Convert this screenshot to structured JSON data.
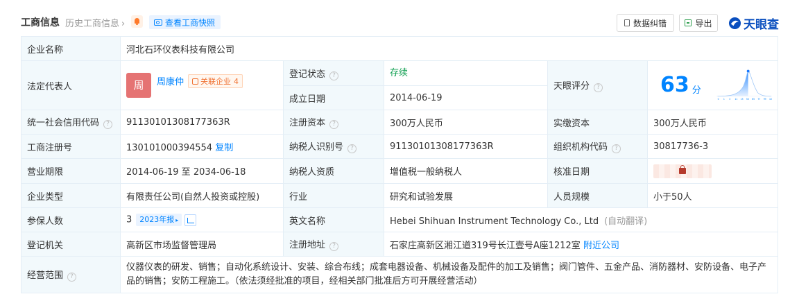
{
  "header": {
    "title": "工商信息",
    "history": "历史工商信息",
    "history_chevron": "›",
    "snapshot": "查看工商快照",
    "correct": "数据纠错",
    "export": "导出",
    "brand": "天眼查"
  },
  "rows": {
    "company_name": {
      "label": "企业名称",
      "value": "河北石环仪表科技有限公司"
    },
    "legal_rep": {
      "label": "法定代表人",
      "avatar": "周",
      "name": "周康仲",
      "assoc_label": "关联企业",
      "assoc_count": "4"
    },
    "reg_status": {
      "label": "登记状态",
      "value": "存续"
    },
    "found_date": {
      "label": "成立日期",
      "value": "2014-06-19"
    },
    "tyc_score": {
      "label": "天眼评分",
      "value": "63",
      "unit": "分",
      "axis": [
        "0",
        "1",
        "3",
        "11",
        "15",
        "50",
        "65",
        "77",
        "99",
        "100"
      ]
    },
    "credit_code": {
      "label": "统一社会信用代码",
      "value": "91130101308177363R"
    },
    "reg_capital": {
      "label": "注册资本",
      "value": "300万人民币"
    },
    "paid_capital": {
      "label": "实缴资本",
      "value": "300万人民币"
    },
    "biz_reg_no": {
      "label": "工商注册号",
      "value": "130101000394554",
      "copy": "复制"
    },
    "taxpayer_id": {
      "label": "纳税人识别号",
      "value": "91130101308177363R"
    },
    "org_code": {
      "label": "组织机构代码",
      "value": "30817736-3"
    },
    "biz_term": {
      "label": "营业期限",
      "value": "2014-06-19 至 2034-06-18"
    },
    "taxpayer_qual": {
      "label": "纳税人资质",
      "value": "增值税一般纳税人"
    },
    "approve_date": {
      "label": "核准日期"
    },
    "company_type": {
      "label": "企业类型",
      "value": "有限责任公司(自然人投资或控股)"
    },
    "industry": {
      "label": "行业",
      "value": "研究和试验发展"
    },
    "staff_size": {
      "label": "人员规模",
      "value": "小于50人"
    },
    "insured": {
      "label": "参保人数",
      "value": "3",
      "report": "2023年报"
    },
    "en_name": {
      "label": "英文名称",
      "value": "Hebei Shihuan Instrument Technology Co., Ltd",
      "auto": "(自动翻译)"
    },
    "reg_authority": {
      "label": "登记机关",
      "value": "高新区市场监督管理局"
    },
    "reg_address": {
      "label": "注册地址",
      "value": "石家庄高新区湘江道319号长江壹号A座1212室",
      "nearby": "附近公司"
    },
    "biz_scope": {
      "label": "经营范围",
      "value": "仪器仪表的研发、销售；自动化系统设计、安装、综合布线；成套电器设备、机械设备及配件的加工及销售；阀门管件、五金产品、消防器材、安防设备、电子产品的销售；安防工程施工。（依法须经批准的项目，经相关部门批准后方可开展经营活动）"
    }
  },
  "colors": {
    "accent": "#0084ff",
    "label_bg": "#f2f9fc",
    "status_green": "#11a052",
    "brand": "#0a4fbf"
  }
}
